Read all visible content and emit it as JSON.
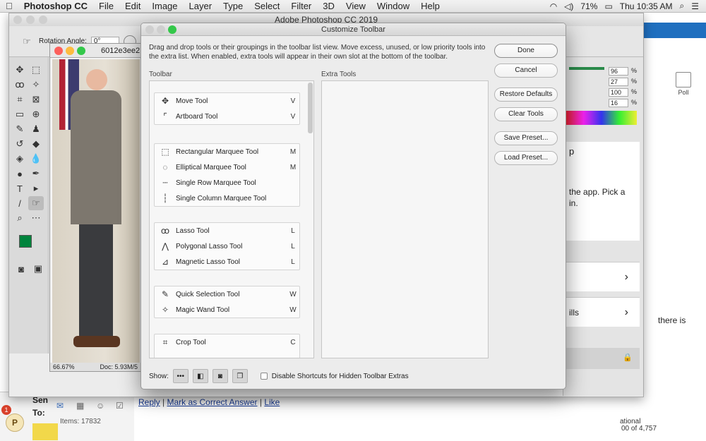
{
  "menubar": {
    "apple": "",
    "app_name": "Photoshop CC",
    "items": [
      "File",
      "Edit",
      "Image",
      "Layer",
      "Type",
      "Select",
      "Filter",
      "3D",
      "View",
      "Window",
      "Help"
    ],
    "battery": "71%",
    "clock": "Thu 10:35 AM"
  },
  "photoshop": {
    "window_title": "Adobe Photoshop CC 2019",
    "rotation_label": "Rotation Angle:",
    "rotation_value": "0°",
    "document_tab": "6012e3ee2",
    "zoom": "66.67%",
    "doc_size": "Doc: 5.93M/5",
    "right_panel_values": [
      "96",
      "27",
      "100",
      "16"
    ],
    "right_panel_unit": "%",
    "panel_text": "the app. Pick a",
    "panel_text2": "in.",
    "panel_text3": "ills"
  },
  "dialog": {
    "title": "Customize Toolbar",
    "description": "Drag and drop tools or their groupings in the toolbar list view. Move excess, unused, or low priority tools into the extra list. When enabled, extra tools will appear in their own slot at the bottom of the toolbar.",
    "toolbar_label": "Toolbar",
    "extra_label": "Extra Tools",
    "groups": [
      {
        "tools": [
          {
            "icon": "✥",
            "name": "Move Tool",
            "key": "V"
          },
          {
            "icon": "⌜",
            "name": "Artboard Tool",
            "key": "V"
          }
        ]
      },
      {
        "tools": [
          {
            "icon": "⬚",
            "name": "Rectangular Marquee Tool",
            "key": "M"
          },
          {
            "icon": "◌",
            "name": "Elliptical Marquee Tool",
            "key": "M"
          },
          {
            "icon": "┄",
            "name": "Single Row Marquee Tool",
            "key": ""
          },
          {
            "icon": "┆",
            "name": "Single Column Marquee Tool",
            "key": ""
          }
        ]
      },
      {
        "tools": [
          {
            "icon": "ꝏ",
            "name": "Lasso Tool",
            "key": "L"
          },
          {
            "icon": "⋀",
            "name": "Polygonal Lasso Tool",
            "key": "L"
          },
          {
            "icon": "⊿",
            "name": "Magnetic Lasso Tool",
            "key": "L"
          }
        ]
      },
      {
        "tools": [
          {
            "icon": "✎",
            "name": "Quick Selection Tool",
            "key": "W"
          },
          {
            "icon": "✧",
            "name": "Magic Wand Tool",
            "key": "W"
          }
        ]
      },
      {
        "tools": [
          {
            "icon": "⌗",
            "name": "Crop Tool",
            "key": "C"
          }
        ]
      }
    ],
    "buttons": {
      "done": "Done",
      "cancel": "Cancel",
      "restore": "Restore Defaults",
      "clear": "Clear Tools",
      "save": "Save Preset...",
      "load": "Load Preset..."
    },
    "show_label": "Show:",
    "disable_shortcuts": "Disable Shortcuts for Hidden Toolbar Extras"
  },
  "browser": {
    "poll_label": "Poll",
    "reply": "Reply",
    "mark_correct": "Mark as Correct Answer",
    "like": "Like",
    "there_is": "there is",
    "count_text": "00 of 4,757",
    "rational": "ational"
  },
  "mail": {
    "items": "Items: 17832",
    "sen": "Sen",
    "to": "To:",
    "badge": "1"
  },
  "colors": {
    "foreground_swatch": "#00843d",
    "accent_link": "#1a3e9b",
    "traffic_red": "#fc605c",
    "traffic_yellow": "#fdbc40",
    "traffic_green": "#34c84a"
  }
}
